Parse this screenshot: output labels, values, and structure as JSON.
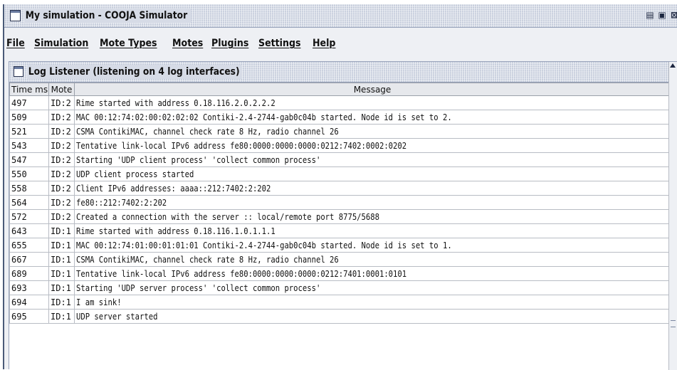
{
  "window": {
    "title": "My simulation - COOJA Simulator",
    "buttons": [
      "restore-icon",
      "maximize-icon",
      "close-icon"
    ]
  },
  "menubar": {
    "items": [
      "File",
      "Simulation",
      "Mote Types",
      "Motes",
      "Plugins",
      "Settings",
      "Help"
    ]
  },
  "log_listener": {
    "title": "Log Listener (listening on 4 log interfaces)",
    "columns": [
      "Time ms",
      "Mote",
      "Message"
    ],
    "rows": [
      {
        "time": "497",
        "mote": "ID:2",
        "message": "Rime started with address 0.18.116.2.0.2.2.2"
      },
      {
        "time": "509",
        "mote": "ID:2",
        "message": "MAC 00:12:74:02:00:02:02:02 Contiki-2.4-2744-gab0c04b started. Node id is set to 2."
      },
      {
        "time": "521",
        "mote": "ID:2",
        "message": "CSMA ContikiMAC, channel check rate 8 Hz, radio channel 26"
      },
      {
        "time": "543",
        "mote": "ID:2",
        "message": "Tentative link-local IPv6 address fe80:0000:0000:0000:0212:7402:0002:0202"
      },
      {
        "time": "547",
        "mote": "ID:2",
        "message": "Starting 'UDP client process' 'collect common process'"
      },
      {
        "time": "550",
        "mote": "ID:2",
        "message": "UDP client process started"
      },
      {
        "time": "558",
        "mote": "ID:2",
        "message": "Client IPv6 addresses: aaaa::212:7402:2:202"
      },
      {
        "time": "564",
        "mote": "ID:2",
        "message": "fe80::212:7402:2:202"
      },
      {
        "time": "572",
        "mote": "ID:2",
        "message": "Created a connection with the server :: local/remote port 8775/5688"
      },
      {
        "time": "643",
        "mote": "ID:1",
        "message": "Rime started with address 0.18.116.1.0.1.1.1"
      },
      {
        "time": "655",
        "mote": "ID:1",
        "message": "MAC 00:12:74:01:00:01:01:01 Contiki-2.4-2744-gab0c04b started. Node id is set to 1."
      },
      {
        "time": "667",
        "mote": "ID:1",
        "message": "CSMA ContikiMAC, channel check rate 8 Hz, radio channel 26"
      },
      {
        "time": "689",
        "mote": "ID:1",
        "message": "Tentative link-local IPv6 address fe80:0000:0000:0000:0212:7401:0001:0101"
      },
      {
        "time": "693",
        "mote": "ID:1",
        "message": "Starting 'UDP server process' 'collect common process'"
      },
      {
        "time": "694",
        "mote": "ID:1",
        "message": "I am sink!"
      },
      {
        "time": "695",
        "mote": "ID:1",
        "message": "UDP server started"
      }
    ]
  }
}
